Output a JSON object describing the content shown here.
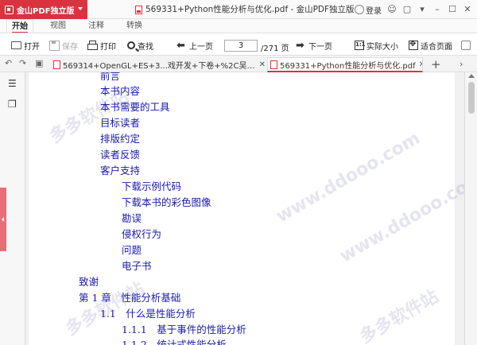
{
  "titlebar": {
    "app_button": "金山PDF独立版",
    "window_title": "569331+Python性能分析与优化.pdf - 金山PDF独立版",
    "login": "登录"
  },
  "menu": {
    "tabs": [
      "开始",
      "视图",
      "注释",
      "转换"
    ]
  },
  "toolbar": {
    "open": "打开",
    "save": "保存",
    "print": "打印",
    "find": "查找",
    "prev_page": "上一页",
    "page_current": "3",
    "page_total": "/271 页",
    "next_page": "下一页",
    "actual_size": "实际大小",
    "fit_page": "适合页面"
  },
  "doc_tabs": [
    {
      "label": "569314+OpenGL+ES+3...戏开发+下卷+%2C吴亚峰.pdf",
      "active": false
    },
    {
      "label": "569331+Python性能分析与优化.pdf",
      "active": true
    }
  ],
  "toc": [
    {
      "text": "前言"
    },
    {
      "text": "本书内容"
    },
    {
      "text": "本书需要的工具"
    },
    {
      "text": "目标读者"
    },
    {
      "text": "排版约定"
    },
    {
      "text": "读者反馈"
    },
    {
      "text": "客户支持"
    },
    {
      "text": "下载示例代码"
    },
    {
      "text": "下载本书的彩色图像"
    },
    {
      "text": "勘误"
    },
    {
      "text": "侵权行为"
    },
    {
      "text": "问题"
    },
    {
      "text": "电子书"
    },
    {
      "text": "致谢"
    },
    {
      "text": "第 1 章　性能分析基础"
    },
    {
      "text": "1.1　什么是性能分析"
    },
    {
      "text": "1.1.1　基于事件的性能分析"
    },
    {
      "text": "1.1.2　统计式性能分析"
    }
  ],
  "watermark": {
    "text_a": "多多软件站",
    "text_b": "www.ddooo.com"
  },
  "colors": {
    "brand": "#d9333f",
    "toc_text": "#1a1ab0"
  }
}
